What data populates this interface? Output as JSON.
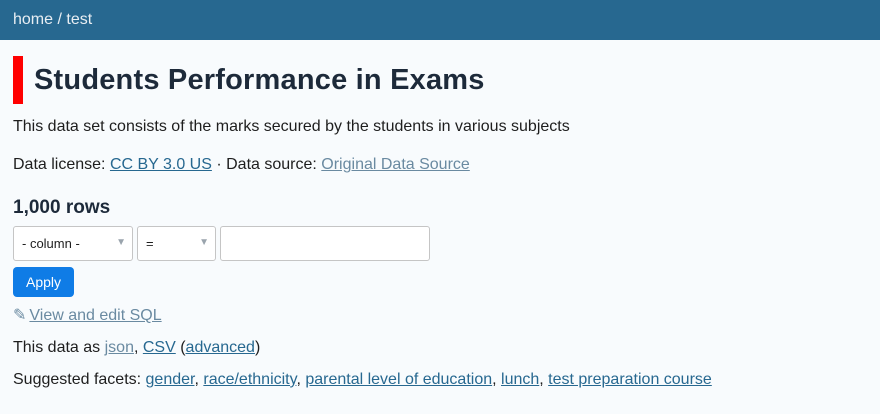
{
  "breadcrumb": {
    "home": "home",
    "sep": " / ",
    "current": "test"
  },
  "page": {
    "title": "Students Performance in Exams",
    "description": "This data set consists of the marks secured by the students in various subjects"
  },
  "license": {
    "label": "Data license: ",
    "license_link": "CC BY 3.0 US",
    "sep": " · ",
    "source_label": "Data source: ",
    "source_link": "Original Data Source"
  },
  "table": {
    "rows_count": "1,000 rows"
  },
  "filter": {
    "column_select": "- column -",
    "operator_select": "=",
    "value_input": "",
    "apply_label": "Apply"
  },
  "sql": {
    "icon": "pencil-icon",
    "label": "View and edit SQL"
  },
  "export": {
    "prefix": "This data as ",
    "json": "json",
    "comma": ", ",
    "csv": "CSV",
    "paren_open": " (",
    "advanced": "advanced",
    "paren_close": ")"
  },
  "facets": {
    "label": "Suggested facets: ",
    "items": [
      "gender",
      "race/ethnicity",
      "parental level of education",
      "lunch",
      "test preparation course"
    ]
  },
  "colors": {
    "topbar": "#276890",
    "accent_bar": "#ff0000",
    "apply_button": "#0f7ce6",
    "link": "#276890"
  }
}
